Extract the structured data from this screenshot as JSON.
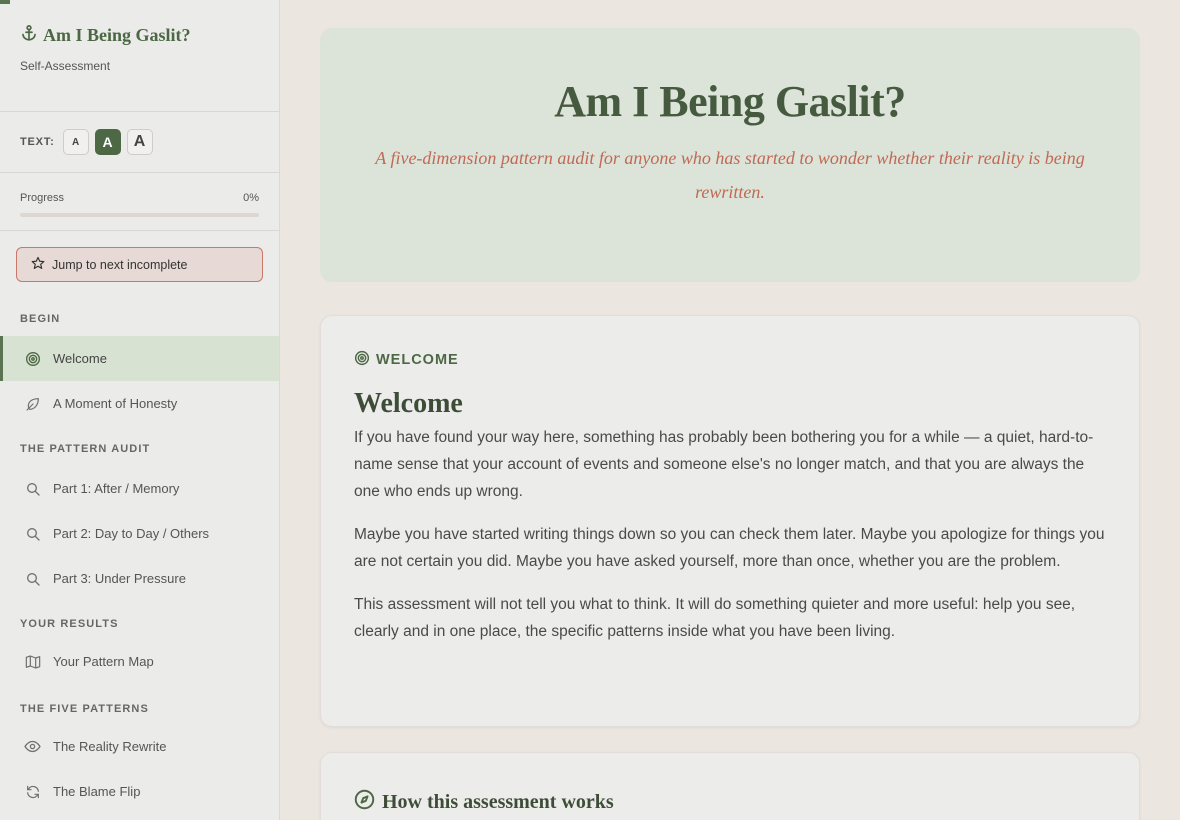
{
  "sidebar": {
    "brand": {
      "icon": "anchor-icon",
      "title": "Am I Being Gaslit?",
      "subtitle": "Self-Assessment"
    },
    "text_size": {
      "label": "TEXT:",
      "small": "A",
      "medium": "A",
      "large": "A",
      "selected": "medium"
    },
    "progress": {
      "label": "Progress",
      "value_text": "0%",
      "value": 0
    },
    "jump_button": {
      "icon": "star-icon",
      "label": "Jump to next incomplete"
    },
    "sections": [
      {
        "label": "BEGIN",
        "items": [
          {
            "label": "Welcome",
            "icon": "target-icon",
            "active": true
          },
          {
            "label": "A Moment of Honesty",
            "icon": "leaf-icon"
          }
        ]
      },
      {
        "label": "THE PATTERN AUDIT",
        "items": [
          {
            "label": "Part 1: After / Memory",
            "icon": "search-icon"
          },
          {
            "label": "Part 2: Day to Day / Others",
            "icon": "search-icon"
          },
          {
            "label": "Part 3: Under Pressure",
            "icon": "search-icon"
          }
        ]
      },
      {
        "label": "YOUR RESULTS",
        "items": [
          {
            "label": "Your Pattern Map",
            "icon": "map-icon"
          }
        ]
      },
      {
        "label": "THE FIVE PATTERNS",
        "items": [
          {
            "label": "The Reality Rewrite",
            "icon": "eye-icon"
          },
          {
            "label": "The Blame Flip",
            "icon": "refresh-icon"
          }
        ]
      }
    ]
  },
  "hero": {
    "title": "Am I Being Gaslit?",
    "subtitle": "A five-dimension pattern audit for anyone who has started to wonder whether their reality is being rewritten."
  },
  "welcome": {
    "eyebrow": "WELCOME",
    "title": "Welcome",
    "paragraphs": [
      "If you have found your way here, something has probably been bothering you for a while — a quiet, hard-to-name sense that your account of events and someone else's no longer match, and that you are always the one who ends up wrong.",
      "Maybe you have started writing things down so you can check them later. Maybe you apologize for things you are not certain you did. Maybe you have asked yourself, more than once, whether you are the problem.",
      "This assessment will not tell you what to think. It will do something quieter and more useful: help you see, clearly and in one place, the specific patterns inside what you have been living."
    ]
  },
  "how_it_works": {
    "icon": "compass-icon",
    "title": "How this assessment works"
  },
  "colors": {
    "accent": "#4d6844",
    "hero_bg": "#dce3d8",
    "hero_subtitle": "#c06a55",
    "jump_border": "#c9786a"
  }
}
